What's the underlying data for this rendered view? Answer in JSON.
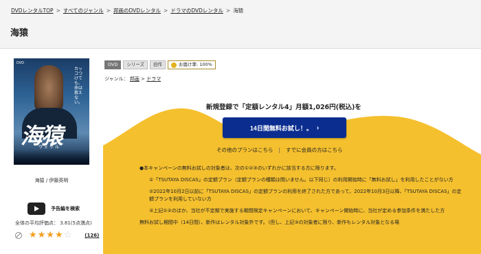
{
  "breadcrumb": [
    "DVDレンタルTOP",
    "すべてのジャンル",
    "邦画のDVDレンタル",
    "ドラマのDVDレンタル",
    "海猿"
  ],
  "breadcrumb_sep": ">",
  "page_title": "海猿",
  "poster": {
    "big_title": "海猿",
    "sub_title": "ウミザル",
    "tagline": "カッコつけても、命は救えない。",
    "mark": "DVD"
  },
  "caption": "海猿 / 伊藤英明",
  "trailer_label": "予告編を検索",
  "avg_rating": "全体の平均評価点：  3.81(5点満点)",
  "rating": {
    "value": 3.81,
    "max": 5,
    "stars_full": "★★★★",
    "stars_off": "☆",
    "count": "(126)"
  },
  "badges": {
    "dvd": "DVD",
    "series": "シリーズ",
    "old": "旧作",
    "ship": "お届け率: 100%"
  },
  "genre": {
    "label": "ジャンル：",
    "items": [
      "邦画",
      "ドラマ"
    ],
    "sep": ">"
  },
  "headline": "新規登録で「定額レンタル4」月額1,026円(税込)を",
  "cta_label": "14日間無料お試し！。",
  "cta_chevron": "›",
  "others": {
    "plans": "その他のプランはこちら",
    "sep": "|",
    "members": "すでに会員の方はこちら"
  },
  "notes": {
    "intro": "●本キャンペーンの無料お試しの対象者は、次の①②③のいずれかに該当する方に限ります。",
    "items": [
      "①「TSUTAYA DISCAS」の定額プラン（定額プランの種類は問いません。以下同じ）の利用開始時に「無料お試し」を利用したことがない方",
      "②2022年10月2日以前に「TSUTAYA DISCAS」の定額プランの利用を終了された方であって、2022年10月3日以降、「TSUTAYA DISCAS」の定額プランを利用していない方",
      "③上記①②のほか、当社が不定期で実施する期間限定キャンペーンにおいて、キャンペーン開始時に、当社が定める参加条件を満たした方"
    ],
    "trailing": "無料お試し期間中（14日間）、新作はレンタル対象外です。（但し、上記③の対象者に限り、新作もレンタル対象となる場"
  },
  "colors": {
    "accent": "#0a2d8f",
    "banner": "#f5c02e",
    "star": "#f29e1c"
  }
}
